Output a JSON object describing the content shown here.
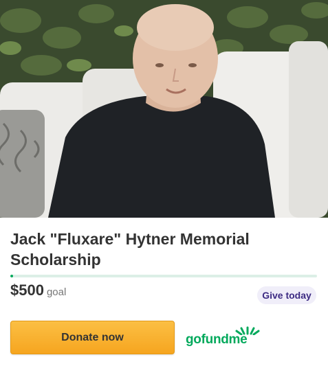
{
  "campaign": {
    "title": "Jack \"Fluxare\" Hytner Memorial Scholarship",
    "goal_amount": "$500",
    "goal_word": "goal",
    "progress_fraction": 0.01,
    "give_today_label": "Give today",
    "donate_label": "Donate now"
  },
  "brand": {
    "logo_text": "gofundme",
    "accent_color": "#02a95c",
    "button_color": "#f6a51f",
    "badge_bg": "#f0eef9",
    "badge_text_color": "#3d2b83"
  },
  "hero_image": {
    "icon": "campaign-photo"
  }
}
